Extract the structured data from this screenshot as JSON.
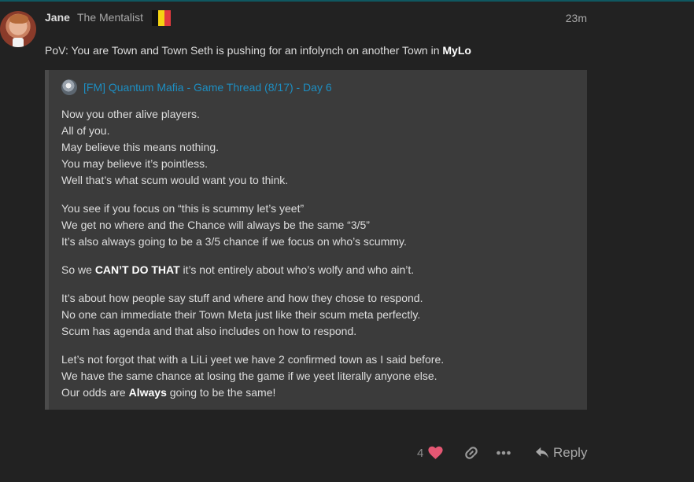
{
  "colors": {
    "background": "#222222",
    "quote_background": "#3b3b3b",
    "link": "#1d8ec2",
    "heart": "#e45773"
  },
  "post": {
    "author": {
      "username": "Jane",
      "full_name": "The Mentalist",
      "flag_icon": "belgium-flag-icon",
      "avatar_icon": "user-avatar"
    },
    "time_ago": "23m",
    "lead": {
      "text": "PoV: You are Town and Town Seth is pushing for an infolynch on another Town in ",
      "bold": "MyLo"
    },
    "quote": {
      "title": "[FM] Quantum Mafia - Game Thread (8/17) - Day 6",
      "title_icon": "thread-avatar-icon",
      "paragraphs": {
        "p1": {
          "l1": "Now you other alive players.",
          "l2": "All of you.",
          "l3": "May believe this means nothing.",
          "l4": "You may believe it’s pointless.",
          "l5": "Well that’s what scum would want you to think."
        },
        "p2": {
          "l1": "You see if you focus on “this is scummy let’s yeet”",
          "l2": "We get no where and the Chance will always be the same “3/5”",
          "l3": "It’s also always going to be a 3/5 chance if we focus on who’s scummy."
        },
        "p3": {
          "pre": "So we ",
          "bold": "CAN’T DO THAT",
          "post": " it’s not entirely about who’s wolfy and who ain’t."
        },
        "p4": {
          "l1": "It’s about how people say stuff and where and how they chose to respond.",
          "l2": "No one can immediate their Town Meta just like their scum meta perfectly.",
          "l3": "Scum has agenda and that also includes on how to respond."
        },
        "p5": {
          "l1": "Let’s not forgot that with a LiLi yeet we have 2 confirmed town as I said before.",
          "l2": "We have the same chance at losing the game if we yeet literally anyone else.",
          "l3_pre": "Our odds are ",
          "l3_bold": "Always",
          "l3_post": " going to be the same!"
        }
      }
    },
    "actions": {
      "like_count": "4",
      "like_icon": "heart-icon",
      "link_icon": "link-icon",
      "more_icon": "ellipsis-icon",
      "reply_icon": "reply-arrow-icon",
      "reply_label": "Reply"
    }
  }
}
